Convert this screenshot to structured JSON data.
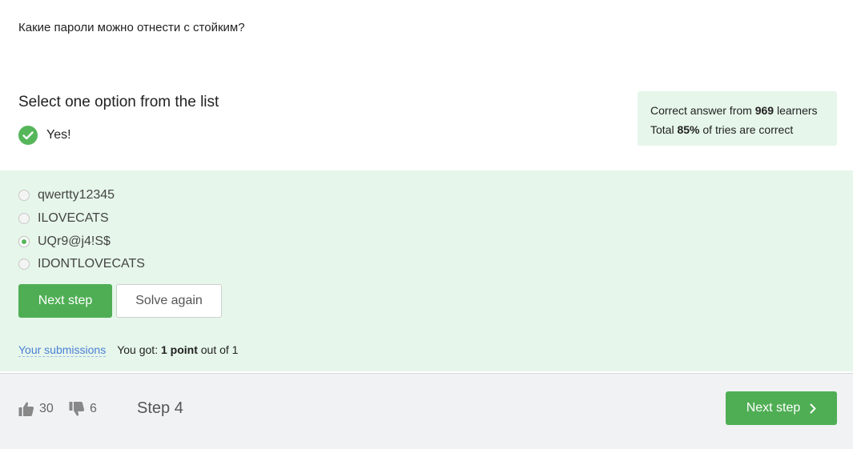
{
  "question": "Какие пароли можно отнести с стойким?",
  "quiz": {
    "title": "Select one option from the list",
    "result_text": "Yes!",
    "result_icon": "check-circle-icon"
  },
  "stats": {
    "line1_prefix": "Correct answer from ",
    "learners": "969",
    "line1_suffix": " learners",
    "line2_prefix": "Total ",
    "percent": "85%",
    "line2_suffix": " of tries are correct"
  },
  "options": [
    {
      "label": "qwertty12345",
      "selected": false
    },
    {
      "label": "ILOVECATS",
      "selected": false
    },
    {
      "label": "UQr9@j4!S$",
      "selected": true
    },
    {
      "label": "IDONTLOVECATS",
      "selected": false
    }
  ],
  "buttons": {
    "next_step": "Next step",
    "solve_again": "Solve again"
  },
  "submissions": {
    "link": "Your submissions",
    "got_prefix": "You got: ",
    "points": "1 point",
    "got_suffix": " out of 1"
  },
  "footer": {
    "likes": "30",
    "dislikes": "6",
    "step_label": "Step 4",
    "next_step": "Next step"
  },
  "colors": {
    "accent_green": "#4fae54",
    "panel_green": "#e6f6ea",
    "link_blue": "#4a7fd6"
  }
}
